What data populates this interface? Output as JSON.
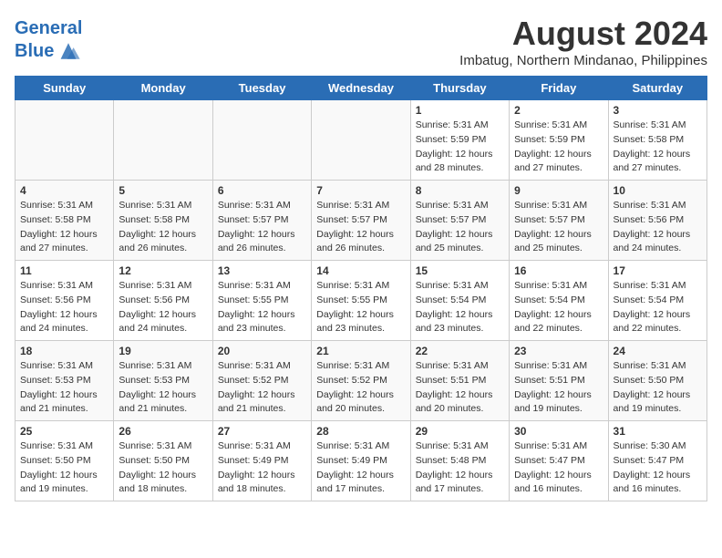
{
  "header": {
    "logo_line1": "General",
    "logo_line2": "Blue",
    "month": "August 2024",
    "location": "Imbatug, Northern Mindanao, Philippines"
  },
  "days_of_week": [
    "Sunday",
    "Monday",
    "Tuesday",
    "Wednesday",
    "Thursday",
    "Friday",
    "Saturday"
  ],
  "weeks": [
    [
      {
        "day": "",
        "empty": true
      },
      {
        "day": "",
        "empty": true
      },
      {
        "day": "",
        "empty": true
      },
      {
        "day": "",
        "empty": true
      },
      {
        "day": "1",
        "sunrise": "5:31 AM",
        "sunset": "5:59 PM",
        "daylight": "12 hours and 28 minutes."
      },
      {
        "day": "2",
        "sunrise": "5:31 AM",
        "sunset": "5:59 PM",
        "daylight": "12 hours and 27 minutes."
      },
      {
        "day": "3",
        "sunrise": "5:31 AM",
        "sunset": "5:58 PM",
        "daylight": "12 hours and 27 minutes."
      }
    ],
    [
      {
        "day": "4",
        "sunrise": "5:31 AM",
        "sunset": "5:58 PM",
        "daylight": "12 hours and 27 minutes."
      },
      {
        "day": "5",
        "sunrise": "5:31 AM",
        "sunset": "5:58 PM",
        "daylight": "12 hours and 26 minutes."
      },
      {
        "day": "6",
        "sunrise": "5:31 AM",
        "sunset": "5:57 PM",
        "daylight": "12 hours and 26 minutes."
      },
      {
        "day": "7",
        "sunrise": "5:31 AM",
        "sunset": "5:57 PM",
        "daylight": "12 hours and 26 minutes."
      },
      {
        "day": "8",
        "sunrise": "5:31 AM",
        "sunset": "5:57 PM",
        "daylight": "12 hours and 25 minutes."
      },
      {
        "day": "9",
        "sunrise": "5:31 AM",
        "sunset": "5:57 PM",
        "daylight": "12 hours and 25 minutes."
      },
      {
        "day": "10",
        "sunrise": "5:31 AM",
        "sunset": "5:56 PM",
        "daylight": "12 hours and 24 minutes."
      }
    ],
    [
      {
        "day": "11",
        "sunrise": "5:31 AM",
        "sunset": "5:56 PM",
        "daylight": "12 hours and 24 minutes."
      },
      {
        "day": "12",
        "sunrise": "5:31 AM",
        "sunset": "5:56 PM",
        "daylight": "12 hours and 24 minutes."
      },
      {
        "day": "13",
        "sunrise": "5:31 AM",
        "sunset": "5:55 PM",
        "daylight": "12 hours and 23 minutes."
      },
      {
        "day": "14",
        "sunrise": "5:31 AM",
        "sunset": "5:55 PM",
        "daylight": "12 hours and 23 minutes."
      },
      {
        "day": "15",
        "sunrise": "5:31 AM",
        "sunset": "5:54 PM",
        "daylight": "12 hours and 23 minutes."
      },
      {
        "day": "16",
        "sunrise": "5:31 AM",
        "sunset": "5:54 PM",
        "daylight": "12 hours and 22 minutes."
      },
      {
        "day": "17",
        "sunrise": "5:31 AM",
        "sunset": "5:54 PM",
        "daylight": "12 hours and 22 minutes."
      }
    ],
    [
      {
        "day": "18",
        "sunrise": "5:31 AM",
        "sunset": "5:53 PM",
        "daylight": "12 hours and 21 minutes."
      },
      {
        "day": "19",
        "sunrise": "5:31 AM",
        "sunset": "5:53 PM",
        "daylight": "12 hours and 21 minutes."
      },
      {
        "day": "20",
        "sunrise": "5:31 AM",
        "sunset": "5:52 PM",
        "daylight": "12 hours and 21 minutes."
      },
      {
        "day": "21",
        "sunrise": "5:31 AM",
        "sunset": "5:52 PM",
        "daylight": "12 hours and 20 minutes."
      },
      {
        "day": "22",
        "sunrise": "5:31 AM",
        "sunset": "5:51 PM",
        "daylight": "12 hours and 20 minutes."
      },
      {
        "day": "23",
        "sunrise": "5:31 AM",
        "sunset": "5:51 PM",
        "daylight": "12 hours and 19 minutes."
      },
      {
        "day": "24",
        "sunrise": "5:31 AM",
        "sunset": "5:50 PM",
        "daylight": "12 hours and 19 minutes."
      }
    ],
    [
      {
        "day": "25",
        "sunrise": "5:31 AM",
        "sunset": "5:50 PM",
        "daylight": "12 hours and 19 minutes."
      },
      {
        "day": "26",
        "sunrise": "5:31 AM",
        "sunset": "5:50 PM",
        "daylight": "12 hours and 18 minutes."
      },
      {
        "day": "27",
        "sunrise": "5:31 AM",
        "sunset": "5:49 PM",
        "daylight": "12 hours and 18 minutes."
      },
      {
        "day": "28",
        "sunrise": "5:31 AM",
        "sunset": "5:49 PM",
        "daylight": "12 hours and 17 minutes."
      },
      {
        "day": "29",
        "sunrise": "5:31 AM",
        "sunset": "5:48 PM",
        "daylight": "12 hours and 17 minutes."
      },
      {
        "day": "30",
        "sunrise": "5:31 AM",
        "sunset": "5:47 PM",
        "daylight": "12 hours and 16 minutes."
      },
      {
        "day": "31",
        "sunrise": "5:30 AM",
        "sunset": "5:47 PM",
        "daylight": "12 hours and 16 minutes."
      }
    ]
  ]
}
